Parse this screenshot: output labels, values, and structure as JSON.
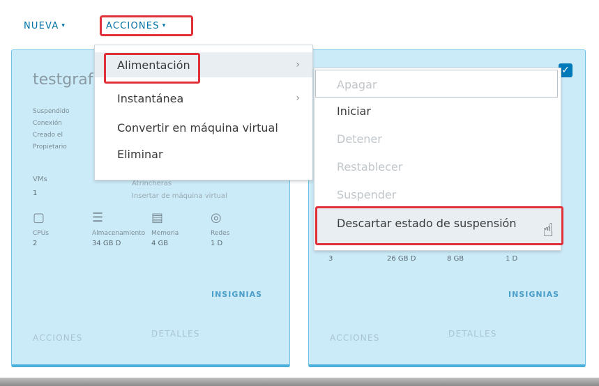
{
  "toolbar": {
    "nueva_label": "NUEVA",
    "acciones_label": "ACCIONES"
  },
  "card1": {
    "title": "testgraf",
    "meta_lines": [
      "Suspendido",
      "Conexión",
      "Creado el",
      "Propietario"
    ],
    "vms_label": "VMs",
    "vms_value": "1",
    "template_line1": "Atrincheras",
    "template_line2": "Insertar de máquina virtual",
    "resources": [
      {
        "icon": "cpu-icon",
        "label": "CPUs",
        "value": "2"
      },
      {
        "icon": "storage-icon",
        "label": "Almacenamiento",
        "value": "34 GB D"
      },
      {
        "icon": "memory-icon",
        "label": "Memoria",
        "value": "4 GB"
      },
      {
        "icon": "network-icon",
        "label": "Redes",
        "value": "1 D"
      }
    ],
    "insignias": "INSIGNIAS",
    "acciones": "ACCIONES",
    "detalles": "DETALLES"
  },
  "card2": {
    "resources": [
      {
        "value": "3"
      },
      {
        "value": "26 GB D"
      },
      {
        "value": "8 GB"
      },
      {
        "value": "1 D"
      }
    ],
    "insignias": "INSIGNIAS",
    "acciones": "ACCIONES",
    "detalles": "DETALLES",
    "checkbox": "✓"
  },
  "menu_main": {
    "items": [
      {
        "label": "Alimentación",
        "has_submenu": true
      },
      {
        "label": "Instantánea",
        "has_submenu": true
      },
      {
        "label": "Convertir en máquina virtual",
        "has_submenu": false
      },
      {
        "label": "Eliminar",
        "has_submenu": false
      }
    ]
  },
  "menu_power": {
    "items": [
      {
        "label": "Apagar",
        "enabled": false
      },
      {
        "label": "Iniciar",
        "enabled": true
      },
      {
        "label": "Detener",
        "enabled": false
      },
      {
        "label": "Restablecer",
        "enabled": false
      },
      {
        "label": "Suspender",
        "enabled": false
      },
      {
        "label": "Descartar estado de suspensión",
        "enabled": true
      }
    ]
  },
  "colors": {
    "accent": "#0072a3",
    "card_bg": "#ccebf9",
    "highlight": "#e0313b"
  }
}
